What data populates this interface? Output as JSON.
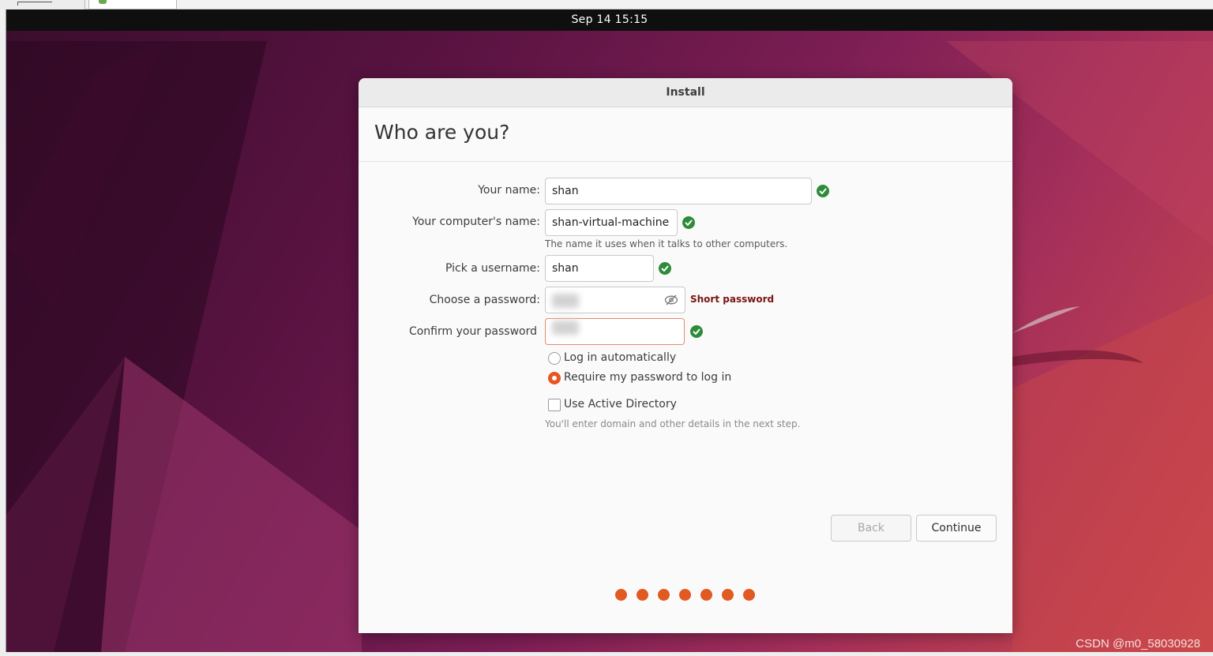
{
  "topbar": {
    "datetime": "Sep 14  15:15"
  },
  "dialog": {
    "title": "Install",
    "heading": "Who are you?",
    "fields": {
      "your_name": {
        "label": "Your name:",
        "value": "shan"
      },
      "computer_name": {
        "label": "Your computer's name:",
        "value": "shan-virtual-machine",
        "hint": "The name it uses when it talks to other computers."
      },
      "username": {
        "label": "Pick a username:",
        "value": "shan"
      },
      "password": {
        "label": "Choose a password:",
        "value": "",
        "strength": "Short password"
      },
      "confirm_password": {
        "label": "Confirm your password",
        "value": ""
      }
    },
    "login_options": [
      {
        "label": "Log in automatically",
        "selected": false
      },
      {
        "label": "Require my password to log in",
        "selected": true
      }
    ],
    "active_directory": {
      "label": "Use Active Directory",
      "checked": false,
      "hint": "You'll enter domain and other details in the next step."
    },
    "buttons": {
      "back": "Back",
      "continue": "Continue"
    },
    "progress": {
      "total_steps": 7
    }
  },
  "watermark": "CSDN @m0_58030928",
  "colors": {
    "accent": "#e95420",
    "progress_dot": "#e05a22",
    "valid_check": "#2e8b3a",
    "short_password": "#7a1414"
  },
  "icons": {
    "valid": "check-circle-icon",
    "show_password": "eye-slash-icon"
  }
}
